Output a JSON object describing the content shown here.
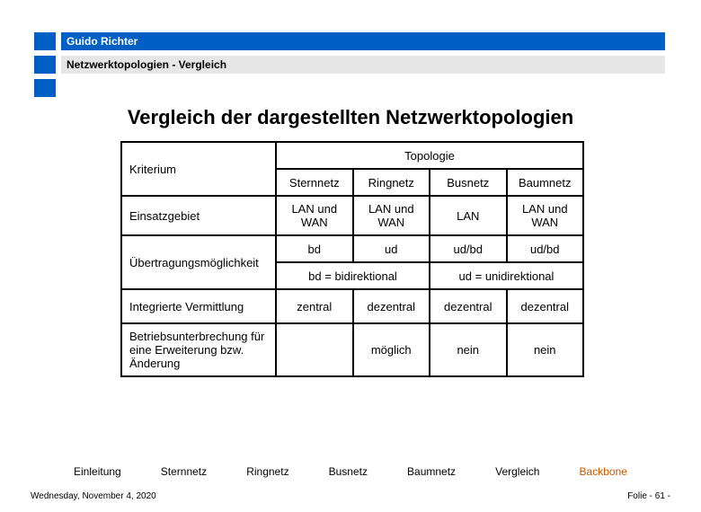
{
  "author": "Guido Richter",
  "breadcrumb": "Netzwerktopologien - Vergleich",
  "title": "Vergleich der dargestellten Netzwerktopologien",
  "table": {
    "criterion_label": "Kriterium",
    "topology_label": "Topologie",
    "columns": [
      "Sternnetz",
      "Ringnetz",
      "Busnetz",
      "Baumnetz"
    ],
    "rows": {
      "einsatz": {
        "label": "Einsatzgebiet",
        "values": [
          "LAN und WAN",
          "LAN und WAN",
          "LAN",
          "LAN und WAN"
        ]
      },
      "direction": {
        "values": [
          "bd",
          "ud",
          "ud/bd",
          "ud/bd"
        ]
      },
      "uebertragung": {
        "label": "Übertragungsmöglichkeit",
        "note_bd": "bd = bidirektional",
        "note_ud": "ud = unidirektional"
      },
      "vermittlung": {
        "label": "Integrierte Vermittlung",
        "values": [
          "zentral",
          "dezentral",
          "dezentral",
          "dezentral"
        ]
      },
      "unterbrechung": {
        "label": "Betriebsunterbrechung für eine Erweiterung bzw. Änderung",
        "values": [
          "",
          "möglich",
          "nein",
          "nein"
        ]
      }
    }
  },
  "nav": [
    "Einleitung",
    "Sternnetz",
    "Ringnetz",
    "Busnetz",
    "Baumnetz",
    "Vergleich",
    "Backbone"
  ],
  "nav_active_index": 6,
  "footer_date": "Wednesday, November 4, 2020",
  "footer_page": "Folie - 61 -"
}
